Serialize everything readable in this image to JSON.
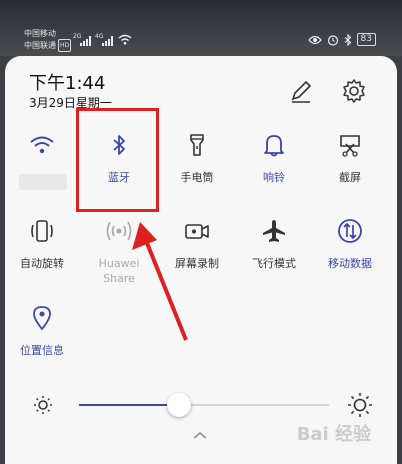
{
  "status_bar": {
    "carrier1": "中国移动",
    "carrier2": "中国联通",
    "hd_badge": "HD",
    "net1": "2G",
    "net2": "4G",
    "battery": "83"
  },
  "header": {
    "time": "下午1:44",
    "date": "3月29日星期一",
    "edit_icon": "pencil-icon",
    "settings_icon": "gear-icon"
  },
  "tiles_row1": [
    {
      "label": "",
      "icon": "wifi-icon",
      "active": true
    },
    {
      "label": "蓝牙",
      "icon": "bluetooth-icon",
      "active": true
    },
    {
      "label": "手电筒",
      "icon": "flashlight-icon",
      "active": false
    },
    {
      "label": "响铃",
      "icon": "bell-icon",
      "active": true
    },
    {
      "label": "截屏",
      "icon": "screenshot-icon",
      "active": false
    }
  ],
  "tiles_row2": [
    {
      "label": "自动旋转",
      "icon": "auto-rotate-icon",
      "active": false
    },
    {
      "label": "Huawei Share",
      "icon": "huawei-share-icon",
      "active": false
    },
    {
      "label": "屏幕录制",
      "icon": "screen-record-icon",
      "active": false
    },
    {
      "label": "飞行模式",
      "icon": "airplane-icon",
      "active": false
    },
    {
      "label": "移动数据",
      "icon": "mobile-data-icon",
      "active": true
    }
  ],
  "tiles_row3": [
    {
      "label": "位置信息",
      "icon": "location-icon",
      "active": true
    }
  ],
  "brightness": {
    "level": 0.4
  },
  "colors": {
    "accent": "#3c46a8",
    "highlight": "#e02020",
    "panel": "#f7f7f8"
  },
  "watermark": "Bai 经验"
}
